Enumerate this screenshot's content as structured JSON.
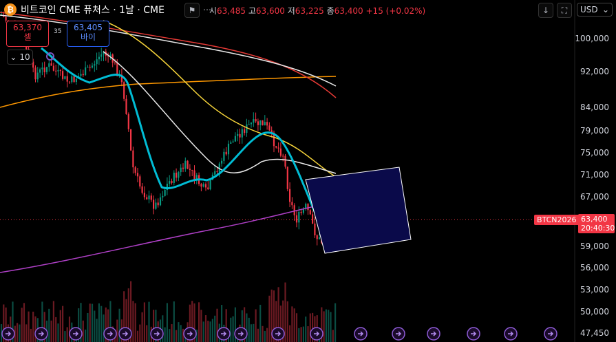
{
  "header": {
    "symbol_logo": "₿",
    "title": "비트코인 CME 퓨처스 · 1날 · CME",
    "ohlc": {
      "o_label": "시",
      "o_value": "63,485",
      "h_label": "고",
      "h_value": "63,600",
      "l_label": "저",
      "l_value": "63,225",
      "c_label": "종",
      "c_value": "63,400",
      "change": "+15 (+0.02%)"
    },
    "icons": [
      "flag-icon",
      "more-icon",
      "down-arrow-icon",
      "fullscreen-icon"
    ]
  },
  "trade": {
    "sell_price": "63,370",
    "sell_label": "셀",
    "buy_price": "63,405",
    "buy_label": "바이",
    "spread": "35"
  },
  "interval": {
    "value": "10"
  },
  "currency": {
    "value": "USD"
  },
  "price_axis": [
    "100,000",
    "92,000",
    "84,000",
    "79,000",
    "75,000",
    "71,000",
    "67,000",
    "63,400",
    "59,000",
    "56,000",
    "53,000",
    "50,000",
    "47,450"
  ],
  "last_price": {
    "symbol": "BTCN2026",
    "price": "63,400",
    "countdown": "20:40:30"
  },
  "colors": {
    "up": "#089981",
    "down": "#f23645",
    "ma_cyan": "#00bcd4",
    "ma_yellow": "#f5d33a",
    "ma_white": "#e8e8e8",
    "ma_red": "#e53935",
    "ma_orange": "#ff9800",
    "ma_purple": "#b040c8",
    "box": "#0a0a4a"
  },
  "chart_data": {
    "type": "candlestick",
    "y_scale": "log",
    "ylim": [
      47450,
      100000
    ],
    "note_marker": "event markers on time axis"
  }
}
